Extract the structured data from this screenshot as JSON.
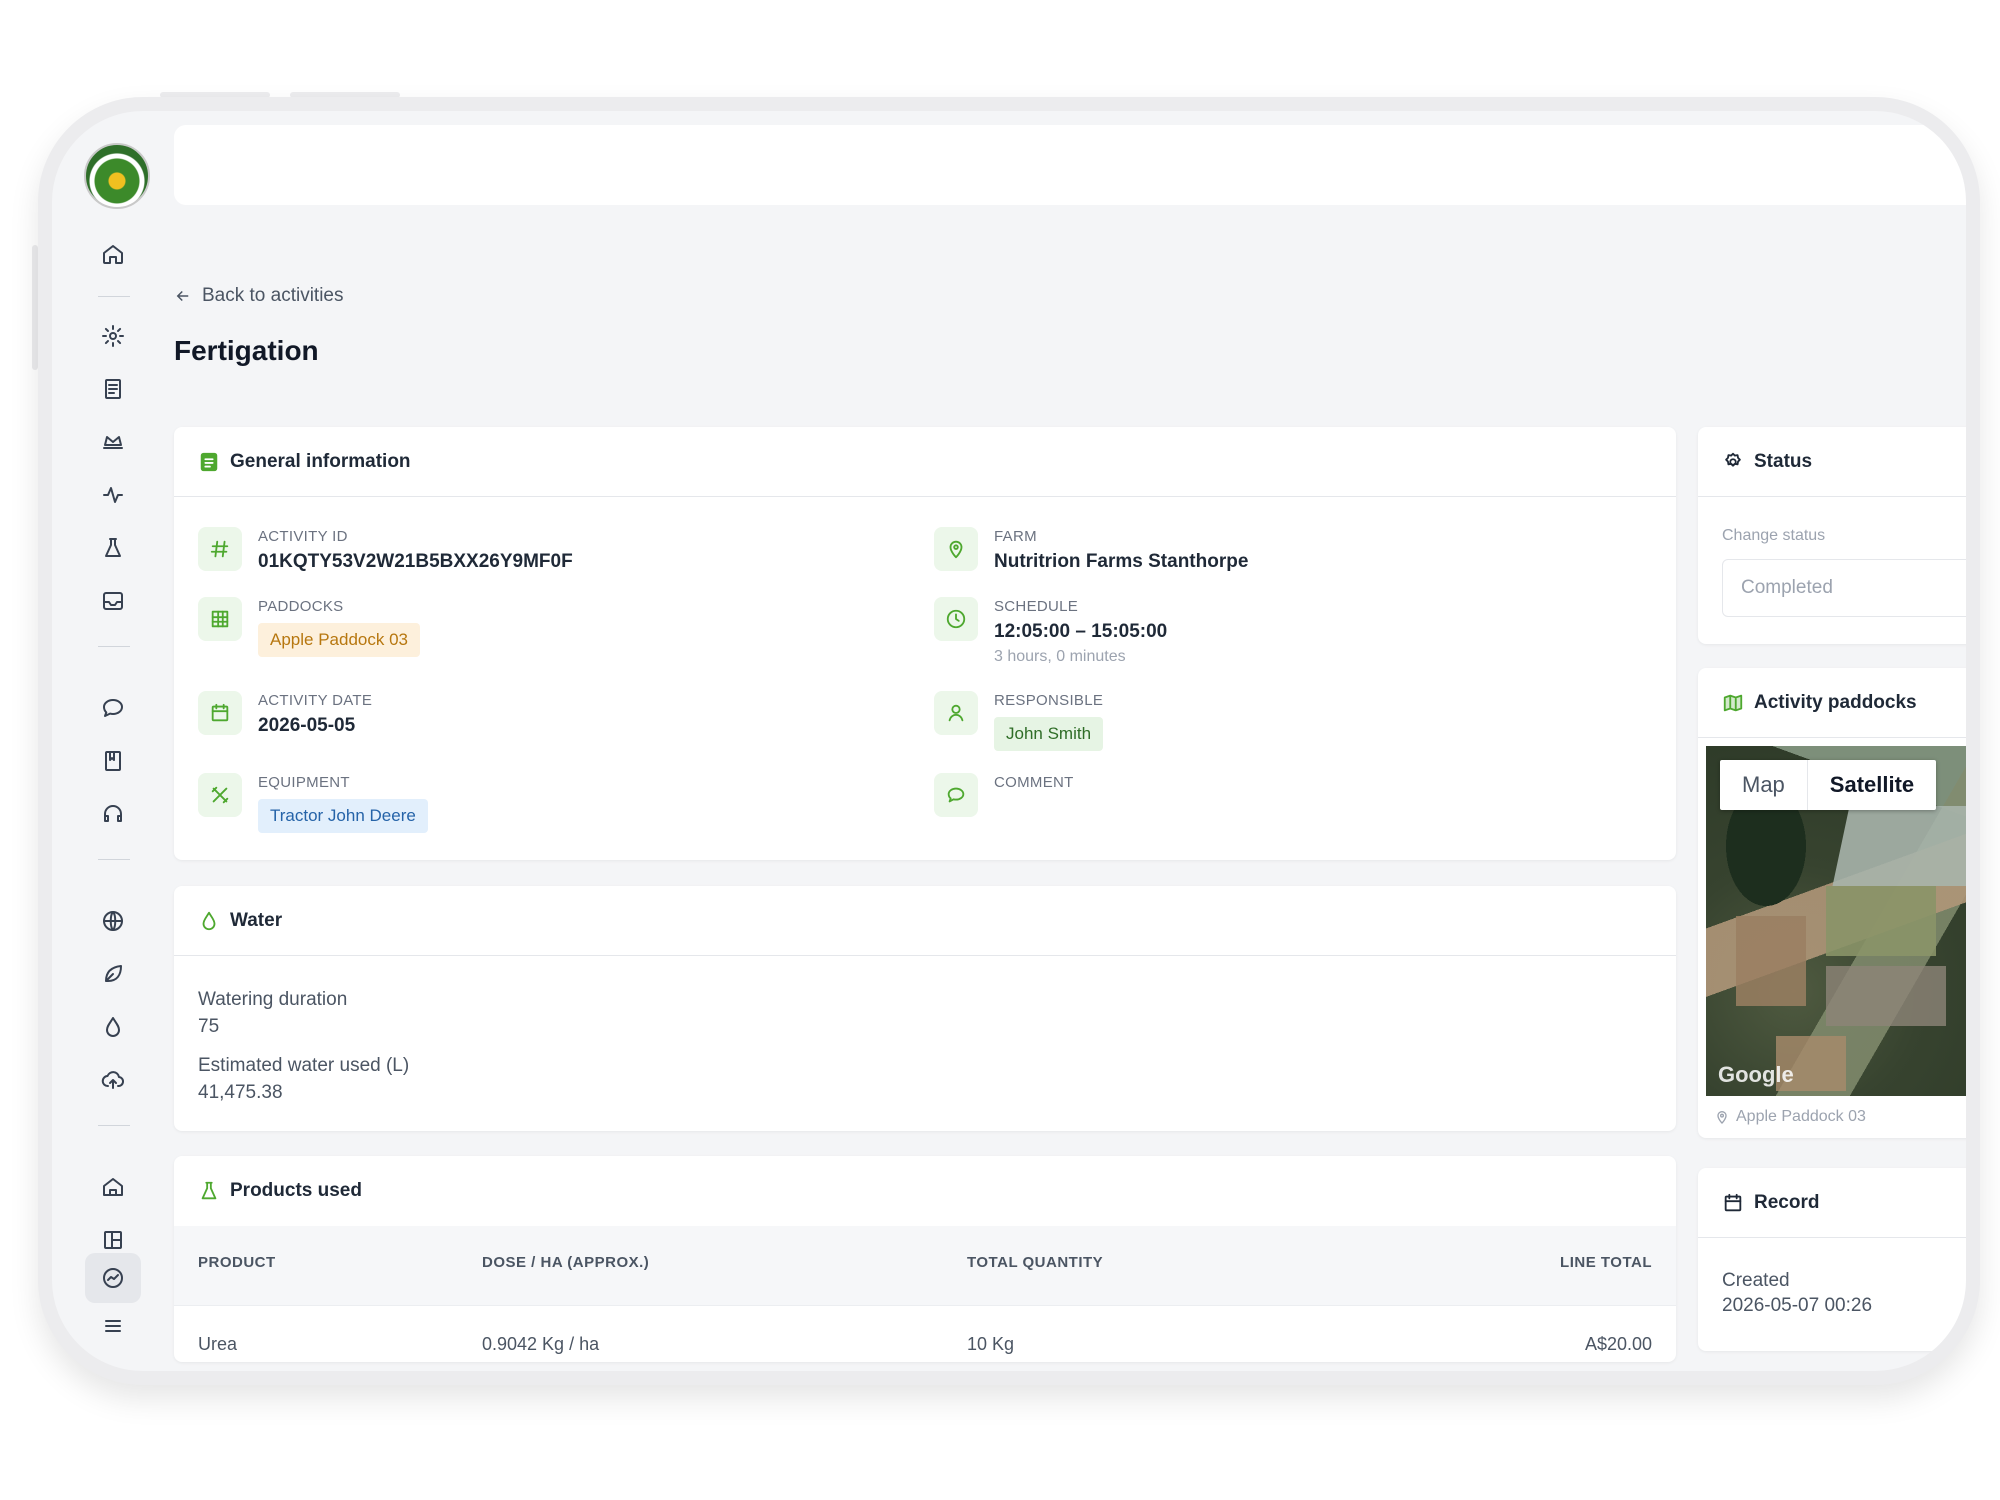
{
  "page": {
    "back_label": "Back to activities",
    "title": "Fertigation"
  },
  "general": {
    "heading": "General information",
    "activity_id_label": "ACTIVITY ID",
    "activity_id": "01KQTY53V2W21B5BXX26Y9MF0F",
    "farm_label": "FARM",
    "farm": "Nutritrion Farms Stanthorpe",
    "paddocks_label": "PADDOCKS",
    "paddock_tag": "Apple Paddock 03",
    "schedule_label": "SCHEDULE",
    "schedule": "12:05:00 – 15:05:00",
    "schedule_duration": "3 hours, 0 minutes",
    "activity_date_label": "ACTIVITY DATE",
    "activity_date": "2026-05-05",
    "responsible_label": "RESPONSIBLE",
    "responsible_tag": "John Smith",
    "equipment_label": "EQUIPMENT",
    "equipment_tag": "Tractor John Deere",
    "comment_label": "COMMENT"
  },
  "water": {
    "heading": "Water",
    "duration_label": "Watering duration",
    "duration_value": "75",
    "estimated_label": "Estimated water used (L)",
    "estimated_value": "41,475.38"
  },
  "products": {
    "heading": "Products used",
    "columns": [
      "PRODUCT",
      "DOSE / HA (APPROX.)",
      "TOTAL QUANTITY",
      "LINE TOTAL"
    ],
    "rows": [
      {
        "product": "Urea",
        "dose": "0.9042 Kg / ha",
        "quantity": "10 Kg",
        "total": "A$20.00"
      }
    ]
  },
  "status": {
    "heading": "Status",
    "change_label": "Change status",
    "selected": "Completed"
  },
  "paddocks": {
    "heading": "Activity paddocks",
    "map_tab": "Map",
    "satellite_tab": "Satellite",
    "map_brand": "Google",
    "caption": "Apple Paddock 03"
  },
  "record": {
    "heading": "Record",
    "created_label": "Created",
    "created_value": "2026-05-07 00:26"
  },
  "colors": {
    "accent_green": "#4ea82f",
    "background": "#f4f5f7"
  }
}
